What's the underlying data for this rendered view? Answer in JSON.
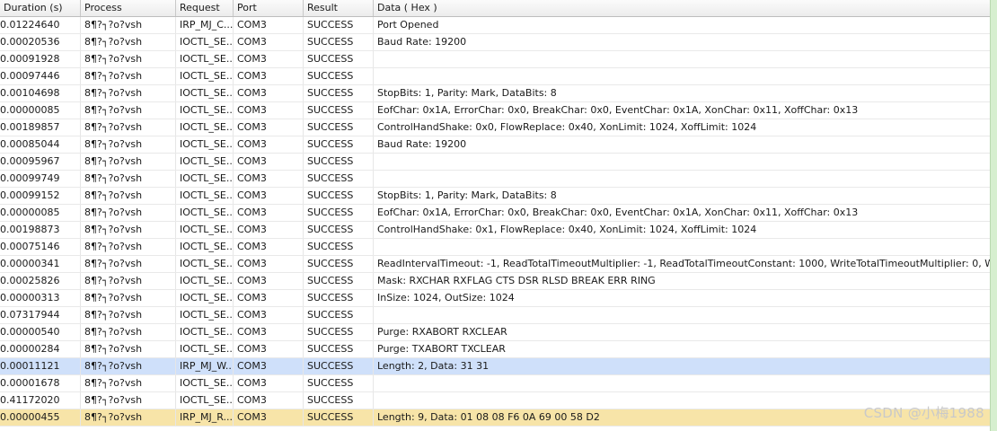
{
  "columns": {
    "duration": "Duration (s)",
    "process": "Process",
    "request": "Request",
    "port": "Port",
    "result": "Result",
    "data": "Data ( Hex )"
  },
  "rows": [
    {
      "duration": "0.01224640",
      "process": "8¶?┐?o?vsh",
      "request": "IRP_MJ_C...",
      "port": "COM3",
      "result": "SUCCESS",
      "data": "Port Opened"
    },
    {
      "duration": "0.00020536",
      "process": "8¶?┐?o?vsh",
      "request": "IOCTL_SE...",
      "port": "COM3",
      "result": "SUCCESS",
      "data": "Baud Rate: 19200"
    },
    {
      "duration": "0.00091928",
      "process": "8¶?┐?o?vsh",
      "request": "IOCTL_SE...",
      "port": "COM3",
      "result": "SUCCESS",
      "data": ""
    },
    {
      "duration": "0.00097446",
      "process": "8¶?┐?o?vsh",
      "request": "IOCTL_SE...",
      "port": "COM3",
      "result": "SUCCESS",
      "data": ""
    },
    {
      "duration": "0.00104698",
      "process": "8¶?┐?o?vsh",
      "request": "IOCTL_SE...",
      "port": "COM3",
      "result": "SUCCESS",
      "data": "StopBits: 1, Parity: Mark, DataBits: 8"
    },
    {
      "duration": "0.00000085",
      "process": "8¶?┐?o?vsh",
      "request": "IOCTL_SE...",
      "port": "COM3",
      "result": "SUCCESS",
      "data": "EofChar: 0x1A, ErrorChar: 0x0, BreakChar: 0x0, EventChar: 0x1A, XonChar: 0x11, XoffChar: 0x13"
    },
    {
      "duration": "0.00189857",
      "process": "8¶?┐?o?vsh",
      "request": "IOCTL_SE...",
      "port": "COM3",
      "result": "SUCCESS",
      "data": "ControlHandShake: 0x0, FlowReplace: 0x40, XonLimit: 1024, XoffLimit: 1024"
    },
    {
      "duration": "0.00085044",
      "process": "8¶?┐?o?vsh",
      "request": "IOCTL_SE...",
      "port": "COM3",
      "result": "SUCCESS",
      "data": "Baud Rate: 19200"
    },
    {
      "duration": "0.00095967",
      "process": "8¶?┐?o?vsh",
      "request": "IOCTL_SE...",
      "port": "COM3",
      "result": "SUCCESS",
      "data": ""
    },
    {
      "duration": "0.00099749",
      "process": "8¶?┐?o?vsh",
      "request": "IOCTL_SE...",
      "port": "COM3",
      "result": "SUCCESS",
      "data": ""
    },
    {
      "duration": "0.00099152",
      "process": "8¶?┐?o?vsh",
      "request": "IOCTL_SE...",
      "port": "COM3",
      "result": "SUCCESS",
      "data": "StopBits: 1, Parity: Mark, DataBits: 8"
    },
    {
      "duration": "0.00000085",
      "process": "8¶?┐?o?vsh",
      "request": "IOCTL_SE...",
      "port": "COM3",
      "result": "SUCCESS",
      "data": "EofChar: 0x1A, ErrorChar: 0x0, BreakChar: 0x0, EventChar: 0x1A, XonChar: 0x11, XoffChar: 0x13"
    },
    {
      "duration": "0.00198873",
      "process": "8¶?┐?o?vsh",
      "request": "IOCTL_SE...",
      "port": "COM3",
      "result": "SUCCESS",
      "data": "ControlHandShake: 0x1, FlowReplace: 0x40, XonLimit: 1024, XoffLimit: 1024"
    },
    {
      "duration": "0.00075146",
      "process": "8¶?┐?o?vsh",
      "request": "IOCTL_SE...",
      "port": "COM3",
      "result": "SUCCESS",
      "data": ""
    },
    {
      "duration": "0.00000341",
      "process": "8¶?┐?o?vsh",
      "request": "IOCTL_SE...",
      "port": "COM3",
      "result": "SUCCESS",
      "data": "ReadIntervalTimeout: -1, ReadTotalTimeoutMultiplier: -1, ReadTotalTimeoutConstant: 1000, WriteTotalTimeoutMultiplier: 0, W..."
    },
    {
      "duration": "0.00025826",
      "process": "8¶?┐?o?vsh",
      "request": "IOCTL_SE...",
      "port": "COM3",
      "result": "SUCCESS",
      "data": "Mask: RXCHAR RXFLAG CTS DSR RLSD BREAK ERR RING"
    },
    {
      "duration": "0.00000313",
      "process": "8¶?┐?o?vsh",
      "request": "IOCTL_SE...",
      "port": "COM3",
      "result": "SUCCESS",
      "data": "InSize: 1024, OutSize: 1024"
    },
    {
      "duration": "0.07317944",
      "process": "8¶?┐?o?vsh",
      "request": "IOCTL_SE...",
      "port": "COM3",
      "result": "SUCCESS",
      "data": ""
    },
    {
      "duration": "0.00000540",
      "process": "8¶?┐?o?vsh",
      "request": "IOCTL_SE...",
      "port": "COM3",
      "result": "SUCCESS",
      "data": "Purge: RXABORT RXCLEAR"
    },
    {
      "duration": "0.00000284",
      "process": "8¶?┐?o?vsh",
      "request": "IOCTL_SE...",
      "port": "COM3",
      "result": "SUCCESS",
      "data": "Purge: TXABORT TXCLEAR"
    },
    {
      "duration": "0.00011121",
      "process": "8¶?┐?o?vsh",
      "request": "IRP_MJ_W...",
      "port": "COM3",
      "result": "SUCCESS",
      "data": "Length: 2, Data: 31 31",
      "highlight": "blue"
    },
    {
      "duration": "0.00001678",
      "process": "8¶?┐?o?vsh",
      "request": "IOCTL_SE...",
      "port": "COM3",
      "result": "SUCCESS",
      "data": ""
    },
    {
      "duration": "0.41172020",
      "process": "8¶?┐?o?vsh",
      "request": "IOCTL_SE...",
      "port": "COM3",
      "result": "SUCCESS",
      "data": ""
    },
    {
      "duration": "0.00000455",
      "process": "8¶?┐?o?vsh",
      "request": "IRP_MJ_R...",
      "port": "COM3",
      "result": "SUCCESS",
      "data": "Length: 9, Data: 01 08 08 F6 0A 69 00 58 D2",
      "highlight": "yellow"
    }
  ],
  "watermark": "CSDN @小梅1988",
  "colors": {
    "selected_blue": "#cfe0fa",
    "selected_yellow": "#f7e4a8",
    "side_bar": "#d6efcf"
  }
}
